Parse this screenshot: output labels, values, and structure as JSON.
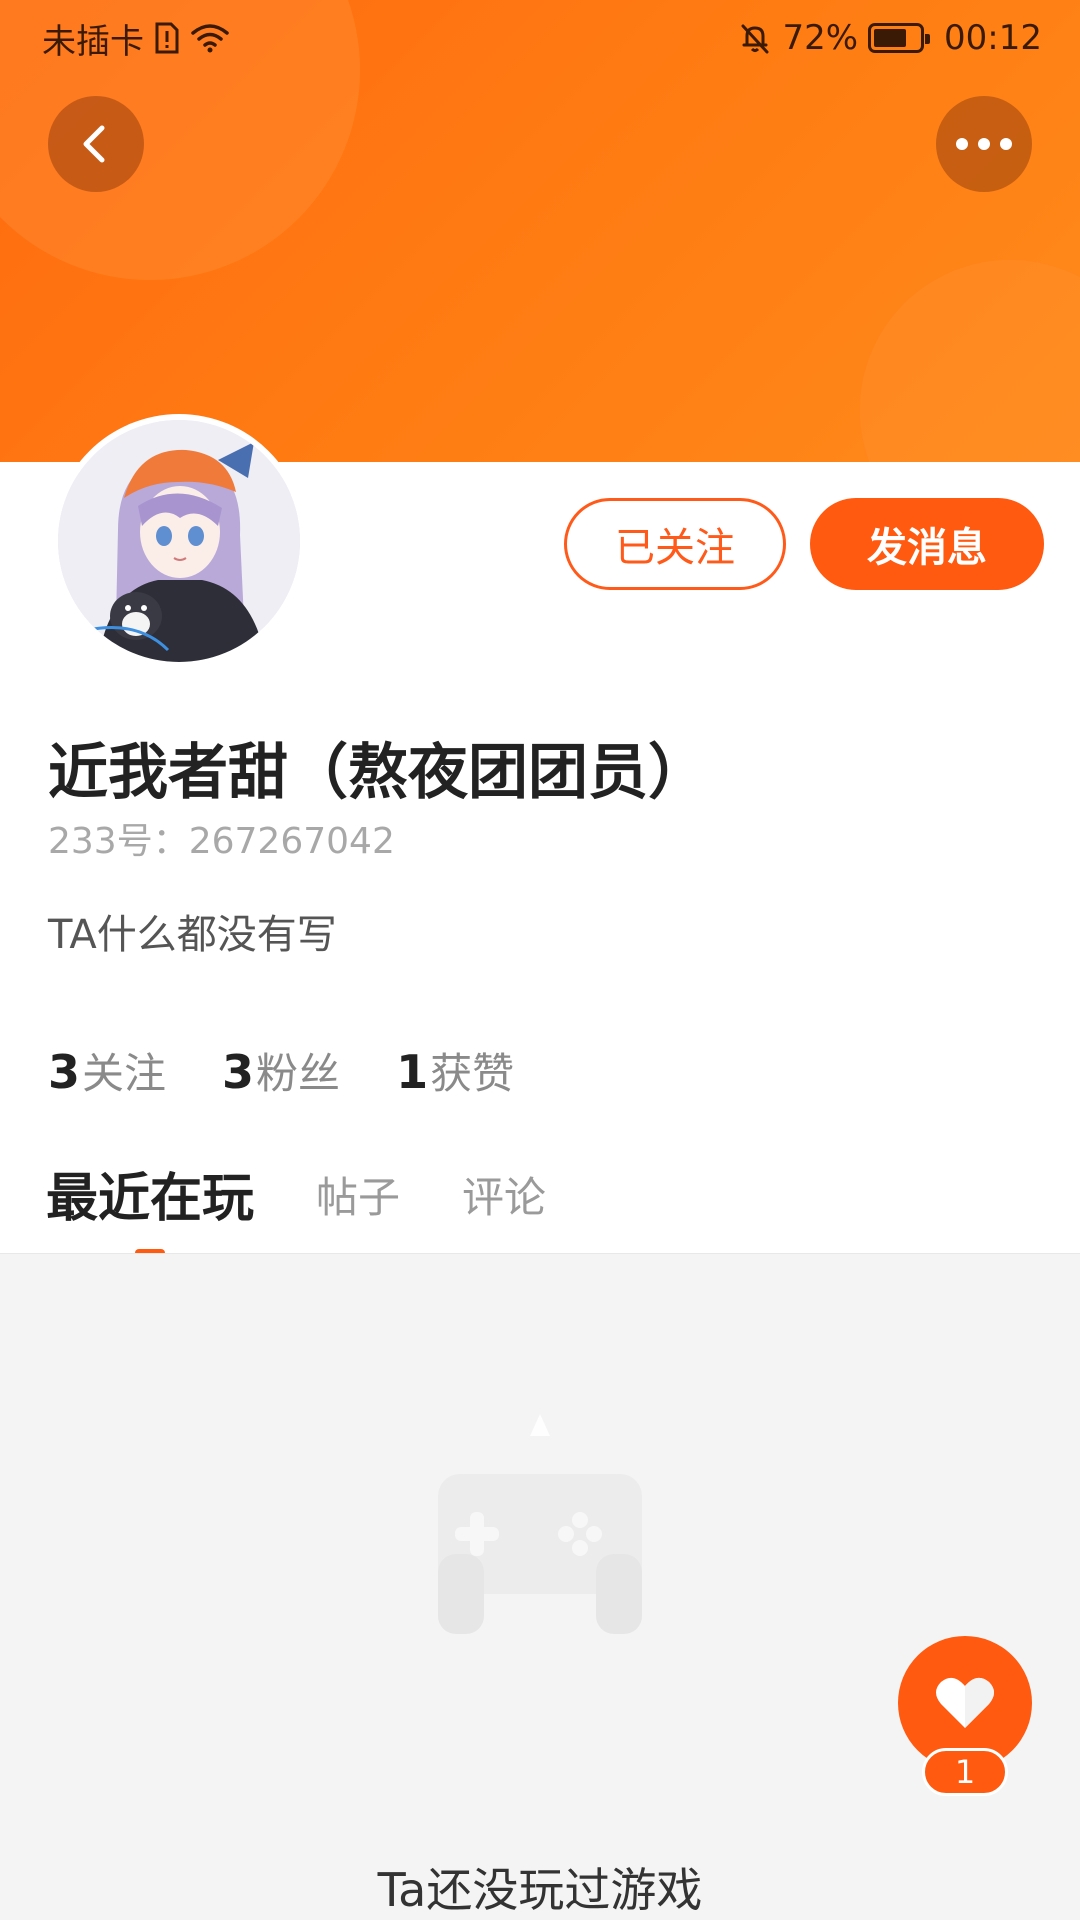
{
  "status_bar": {
    "carrier": "未插卡",
    "battery_percent": "72%",
    "battery_level": 0.72,
    "time": "00:12"
  },
  "header": {
    "back_icon": "chevron-left-icon",
    "more_icon": "more-dots-icon"
  },
  "profile": {
    "avatar_description": "anime-girl-avatar",
    "nickname": "近我者甜（熬夜团团员）",
    "uid": "233号：267267042",
    "bio": "TA什么都没有写",
    "follow_button_label": "已关注",
    "message_button_label": "发消息"
  },
  "stats": [
    {
      "count": "3",
      "label": "关注"
    },
    {
      "count": "3",
      "label": "粉丝"
    },
    {
      "count": "1",
      "label": "获赞"
    }
  ],
  "tabs": [
    {
      "label": "最近在玩",
      "active": true
    },
    {
      "label": "帖子",
      "active": false
    },
    {
      "label": "评论",
      "active": false
    }
  ],
  "content": {
    "empty_icon": "gamepad-icon",
    "empty_text": "Ta还没玩过游戏"
  },
  "like_fab": {
    "icon": "heart-icon",
    "count": "1"
  },
  "colors": {
    "accent": "#ff5a10",
    "banner_start": "#ff6a10",
    "banner_end": "#ff8a1a"
  }
}
